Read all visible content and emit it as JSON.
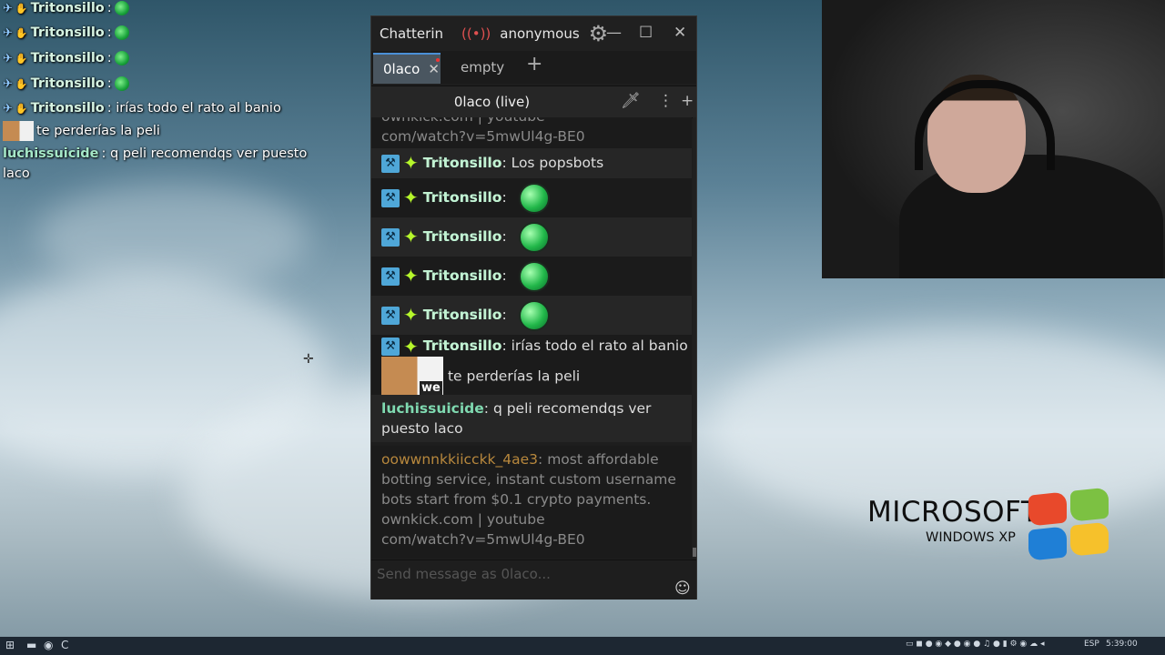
{
  "overlay": {
    "lines": [
      {
        "name": "Tritonsillo",
        "text": ":"
      },
      {
        "name": "Tritonsillo",
        "text": ":"
      },
      {
        "name": "Tritonsillo",
        "text": ":"
      },
      {
        "name": "Tritonsillo",
        "text": ":"
      },
      {
        "name": "Tritonsillo",
        "text": ": irías todo el rato al banio"
      }
    ],
    "cat_text": "te perderías la peli",
    "luchi_name": "luchissuicide",
    "luchi_text": ": q peli recomendqs ver puesto",
    "luchi_text2": "laco"
  },
  "window": {
    "app_title": "Chatterin",
    "account": "anonymous",
    "minimize": "—",
    "maximize": "☐",
    "close": "✕",
    "tabs": [
      {
        "label": "0laco",
        "close": "✕"
      },
      {
        "label": "empty"
      }
    ],
    "add_tab": "+",
    "channel_title": "0laco (live)",
    "input_placeholder": "Send message as 0laco..."
  },
  "messages": {
    "top_spam_1": "ownkick.com | youtube",
    "top_spam_2": "com/watch?v=5mwUl4g-BE0",
    "m1_name": "Tritonsillo",
    "m1_text": ": Los popsbots",
    "m2_name": "Tritonsillo",
    "m2_text": ":",
    "m3_name": "Tritonsillo",
    "m3_text": ":",
    "m4_name": "Tritonsillo",
    "m4_text": ":",
    "m5_name": "Tritonsillo",
    "m5_text": ":",
    "m6_name": "Tritonsillo",
    "m6_text": ": irías todo el rato al banio",
    "cat_label": "we",
    "cat_text": "te perderías la peli",
    "luchi_name": "luchissuicide",
    "luchi_text": ": q peli recomendqs ver",
    "luchi_text2": "puesto laco",
    "spam_name": "oowwnnkkiicckk_4ae3",
    "spam_text": ": most affordable",
    "spam_l2": "botting service, instant custom username",
    "spam_l3": "bots start from $0.1 crypto payments.",
    "spam_l4": "ownkick.com | youtube",
    "spam_l5": "com/watch?v=5mwUl4g-BE0"
  },
  "desktop": {
    "ms": "MICROSOFT",
    "winxp": "WINDOWS XP"
  },
  "taskbar": {
    "lang": "ESP",
    "time": "5:39:00"
  },
  "colors": {
    "accent": "#4a8fd6",
    "mod_badge": "#4fa7d8",
    "username": "#c2f2d2",
    "spam_name": "#b8883d",
    "live": "#e05050"
  }
}
